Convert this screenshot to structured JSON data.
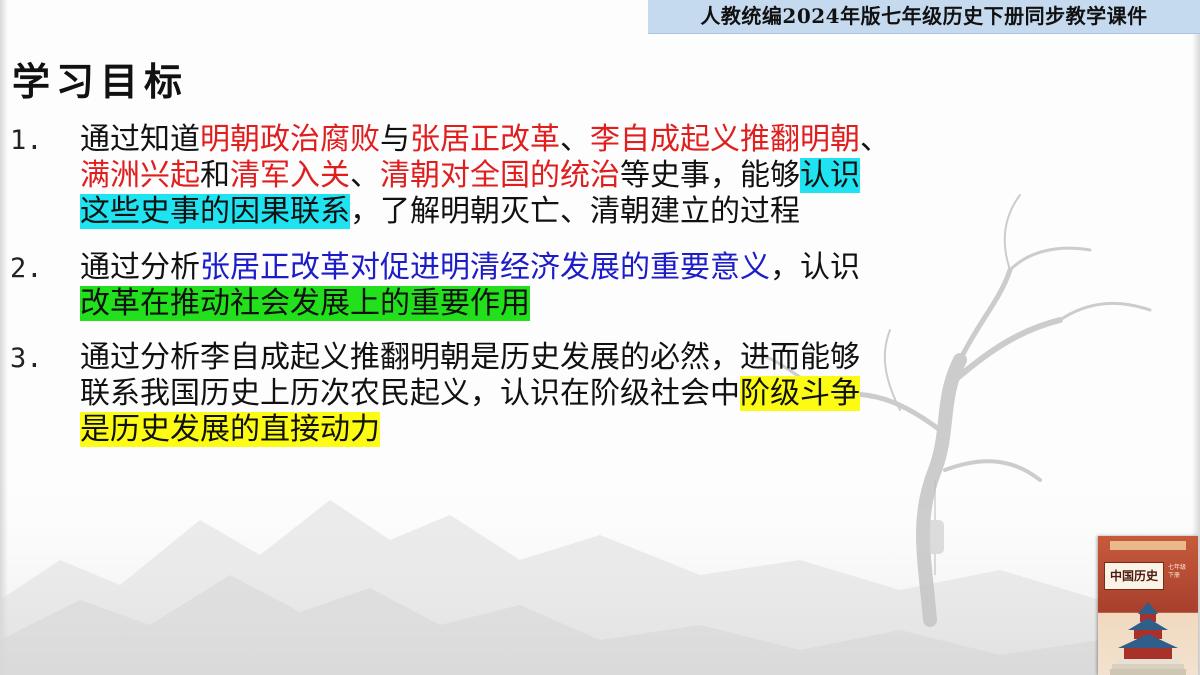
{
  "header": {
    "banner_text": "人教统编2024年版七年级历史下册同步教学课件"
  },
  "page_title": "学习目标",
  "objectives": [
    {
      "number": "1.",
      "lines": [
        [
          {
            "text": "通过知道",
            "style": "plain"
          },
          {
            "text": "明朝政治腐败",
            "style": "red"
          },
          {
            "text": "与",
            "style": "plain"
          },
          {
            "text": "张居正改革",
            "style": "red"
          },
          {
            "text": "、",
            "style": "plain"
          },
          {
            "text": "李自成起义推翻明朝",
            "style": "red"
          },
          {
            "text": "、",
            "style": "plain"
          }
        ],
        [
          {
            "text": "满洲兴起",
            "style": "red"
          },
          {
            "text": "和",
            "style": "plain"
          },
          {
            "text": "清军入关",
            "style": "red"
          },
          {
            "text": "、",
            "style": "plain"
          },
          {
            "text": "清朝对全国的统治",
            "style": "red"
          },
          {
            "text": "等史事，能够",
            "style": "plain"
          },
          {
            "text": "认识",
            "style": "hl-cyan"
          }
        ],
        [
          {
            "text": "这些史事的因果联系",
            "style": "hl-cyan"
          },
          {
            "text": "，了解明朝灭亡、清朝建立的过程",
            "style": "plain"
          }
        ]
      ]
    },
    {
      "number": "2.",
      "lines": [
        [
          {
            "text": "通过分析",
            "style": "plain"
          },
          {
            "text": "张居正改革对促进明清经济发展的重要意义",
            "style": "blue"
          },
          {
            "text": "，认识",
            "style": "plain"
          }
        ],
        [
          {
            "text": "改革在推动社会发展上的重要作用",
            "style": "hl-green"
          }
        ]
      ]
    },
    {
      "number": "3.",
      "lines": [
        [
          {
            "text": "通过分析李自成起义推翻明朝是历史发展的必然，进而能够",
            "style": "plain"
          }
        ],
        [
          {
            "text": "联系我国历史上历次农民起义，认识在阶级社会中",
            "style": "plain"
          },
          {
            "text": "阶级斗争",
            "style": "hl-yellow"
          }
        ],
        [
          {
            "text": "是历史发展的直接动力",
            "style": "hl-yellow"
          }
        ]
      ]
    }
  ],
  "textbook_cover": {
    "title": "中国历史",
    "grade": "七年级 下册",
    "icon": "temple-of-heaven-icon"
  }
}
